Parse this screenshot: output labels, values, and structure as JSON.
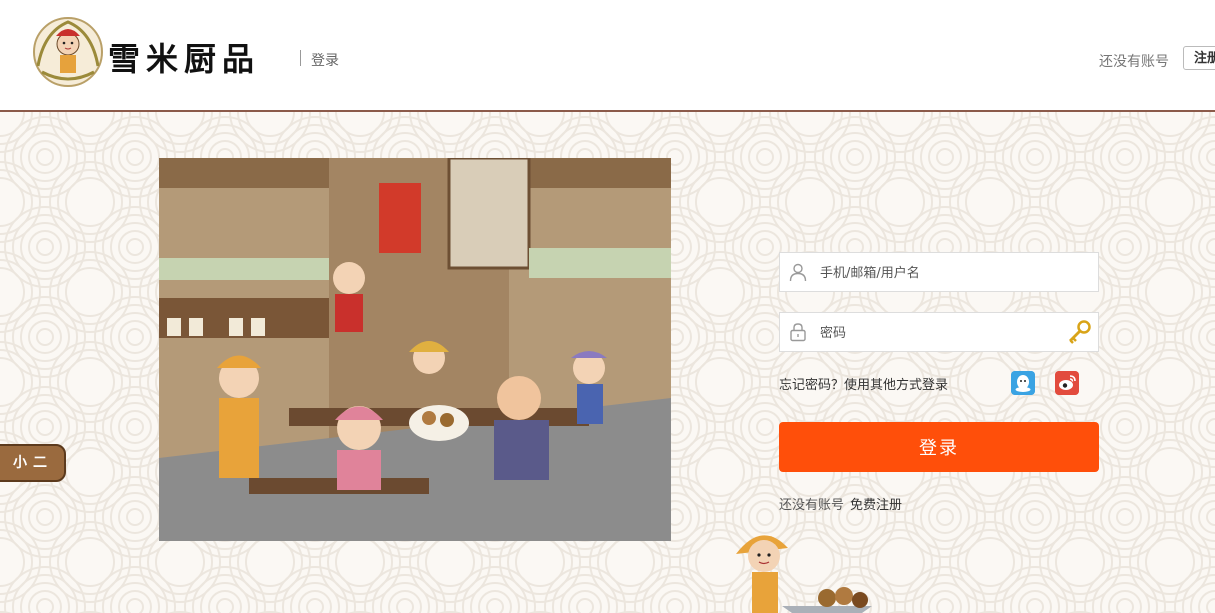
{
  "header": {
    "brand": "雪米厨品",
    "login_label": "登录",
    "no_account_text": "还没有账号",
    "register_label": "注册"
  },
  "side_tab": {
    "label": "小二"
  },
  "login_form": {
    "username_placeholder": "手机/邮箱/用户名",
    "password_placeholder": "密码",
    "forgot_password": "忘记密码？",
    "other_login": "使用其他方式登录",
    "submit_label": "登录",
    "no_account_text": "还没有账号",
    "free_register": "免费注册"
  },
  "colors": {
    "accent": "#ff4f0a",
    "header_border": "#8b5a4a",
    "qq": "#3aa3e3",
    "weibo": "#e24b3d"
  },
  "icons": [
    "user-icon",
    "lock-icon",
    "key-icon",
    "qq-icon",
    "weibo-icon"
  ]
}
